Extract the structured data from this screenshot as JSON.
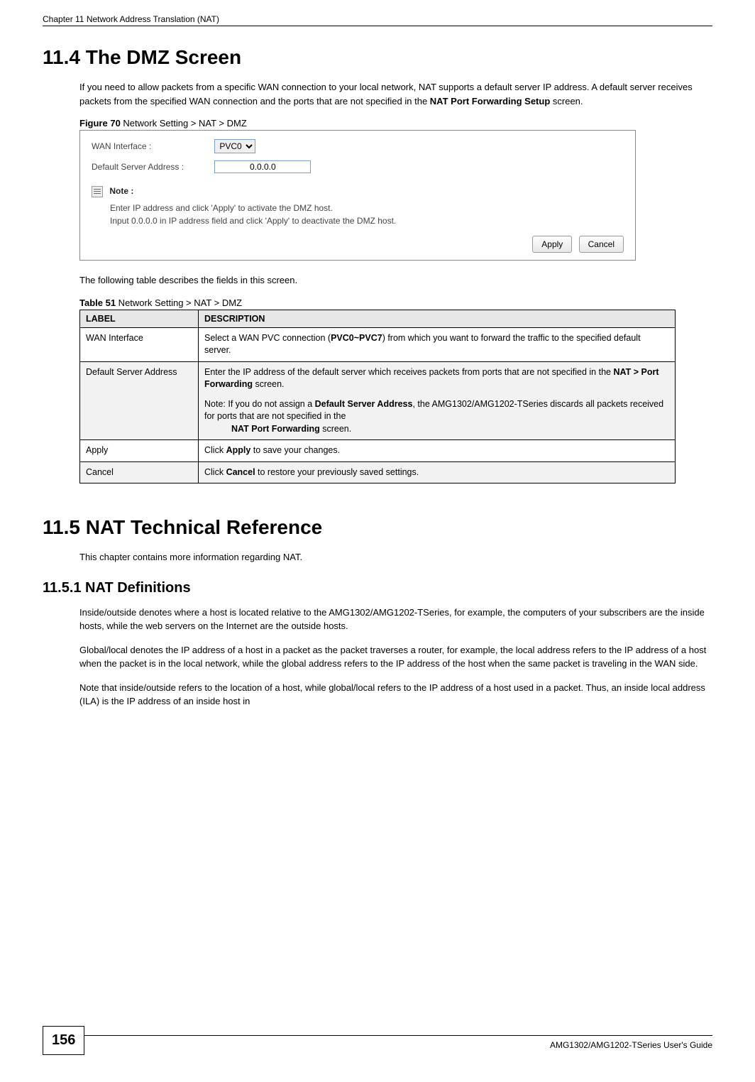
{
  "header": {
    "chapter_line": "Chapter 11 Network Address Translation (NAT)"
  },
  "section_114": {
    "heading": "11.4  The DMZ Screen",
    "intro_before_bold": "If you need to allow packets from a specific WAN connection to your local network, NAT supports a default server IP address. A default server receives packets from the specified WAN connection and the ports that are not specified in the ",
    "intro_bold": "NAT Port Forwarding Setup",
    "intro_after_bold": " screen."
  },
  "figure70": {
    "label": "Figure 70",
    "caption": "   Network Setting > NAT > DMZ",
    "wan_label": "WAN Interface :",
    "wan_value": "PVC0",
    "default_label": "Default Server Address :",
    "default_value": "0.0.0.0",
    "note_title": "Note :",
    "note_line1": "Enter IP address and click 'Apply' to activate the DMZ host.",
    "note_line2": "Input 0.0.0.0 in IP address field and click 'Apply' to deactivate the DMZ host.",
    "apply": "Apply",
    "cancel": "Cancel"
  },
  "between_text": "The following table describes the fields in this screen.",
  "table51": {
    "label": "Table 51",
    "caption": "   Network Setting > NAT > DMZ",
    "head_label": "LABEL",
    "head_desc": "DESCRIPTION",
    "rows": [
      {
        "label": "WAN Interface",
        "desc_before": "Select a WAN PVC connection (",
        "desc_bold_range": "PVC0~PVC7",
        "desc_after": ") from which you want to forward the traffic to the specified default server."
      },
      {
        "label": "Default Server Address",
        "desc_before": "Enter the IP address of the default server which receives packets from ports that are not specified in the ",
        "desc_bold1": "NAT > Port Forwarding",
        "desc_mid1": " screen.",
        "note_prefix": "Note: If you do not assign a ",
        "note_bold1": "Default Server Address",
        "note_mid": ", the AMG1302/AMG1202-TSeries discards all packets received for ports that are not specified in the ",
        "note_bold2": "NAT Port Forwarding",
        "note_end": " screen."
      },
      {
        "label": "Apply",
        "desc_before": "Click ",
        "desc_bold": "Apply",
        "desc_after": " to save your changes."
      },
      {
        "label": "Cancel",
        "desc_before": "Click ",
        "desc_bold": "Cancel",
        "desc_after": " to restore your previously saved settings."
      }
    ]
  },
  "section_115": {
    "heading": "11.5  NAT Technical Reference",
    "intro": "This chapter contains more information regarding NAT."
  },
  "section_1151": {
    "heading": "11.5.1  NAT Definitions",
    "p1": "Inside/outside denotes where a host is located relative to the AMG1302/AMG1202-TSeries, for example, the computers of your subscribers are the inside hosts, while the web servers on the Internet are the outside hosts.",
    "p2": "Global/local denotes the IP address of a host in a packet as the packet traverses a router, for example, the local address refers to the IP address of a host when the packet is in the local network, while the global address refers to the IP address of the host when the same packet is traveling in the WAN side.",
    "p3": "Note that inside/outside refers to the location of a host, while global/local refers to the IP address of a host used in a packet. Thus, an inside local address (ILA) is the IP address of an inside host in"
  },
  "footer": {
    "page_number": "156",
    "guide": "AMG1302/AMG1202-TSeries User's Guide"
  }
}
